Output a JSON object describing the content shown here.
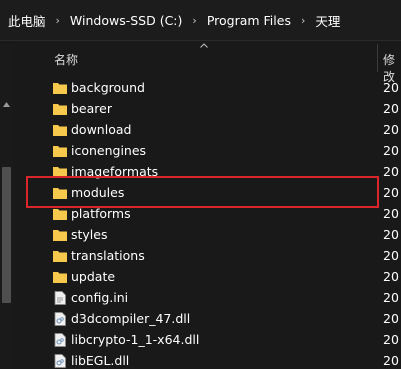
{
  "breadcrumb": {
    "items": [
      "此电脑",
      "Windows-SSD (C:)",
      "Program Files",
      "天理"
    ],
    "separator": "›"
  },
  "header": {
    "name_label": "名称",
    "date_label": "修改"
  },
  "rows": [
    {
      "name": "background",
      "type": "folder",
      "date": "20"
    },
    {
      "name": "bearer",
      "type": "folder",
      "date": "20"
    },
    {
      "name": "download",
      "type": "folder",
      "date": "20"
    },
    {
      "name": "iconengines",
      "type": "folder",
      "date": "20"
    },
    {
      "name": "imageformats",
      "type": "folder",
      "date": "20"
    },
    {
      "name": "modules",
      "type": "folder",
      "date": "20"
    },
    {
      "name": "platforms",
      "type": "folder",
      "date": "20"
    },
    {
      "name": "styles",
      "type": "folder",
      "date": "20"
    },
    {
      "name": "translations",
      "type": "folder",
      "date": "20"
    },
    {
      "name": "update",
      "type": "folder",
      "date": "20"
    },
    {
      "name": "config.ini",
      "type": "ini",
      "date": "20"
    },
    {
      "name": "d3dcompiler_47.dll",
      "type": "dll",
      "date": "20"
    },
    {
      "name": "libcrypto-1_1-x64.dll",
      "type": "dll",
      "date": "20"
    },
    {
      "name": "libEGL.dll",
      "type": "dll",
      "date": "20"
    }
  ],
  "highlighted_row": "modules",
  "colors": {
    "folder": "#f6c84c",
    "highlight_border": "#d9262d",
    "background": "#191919"
  }
}
